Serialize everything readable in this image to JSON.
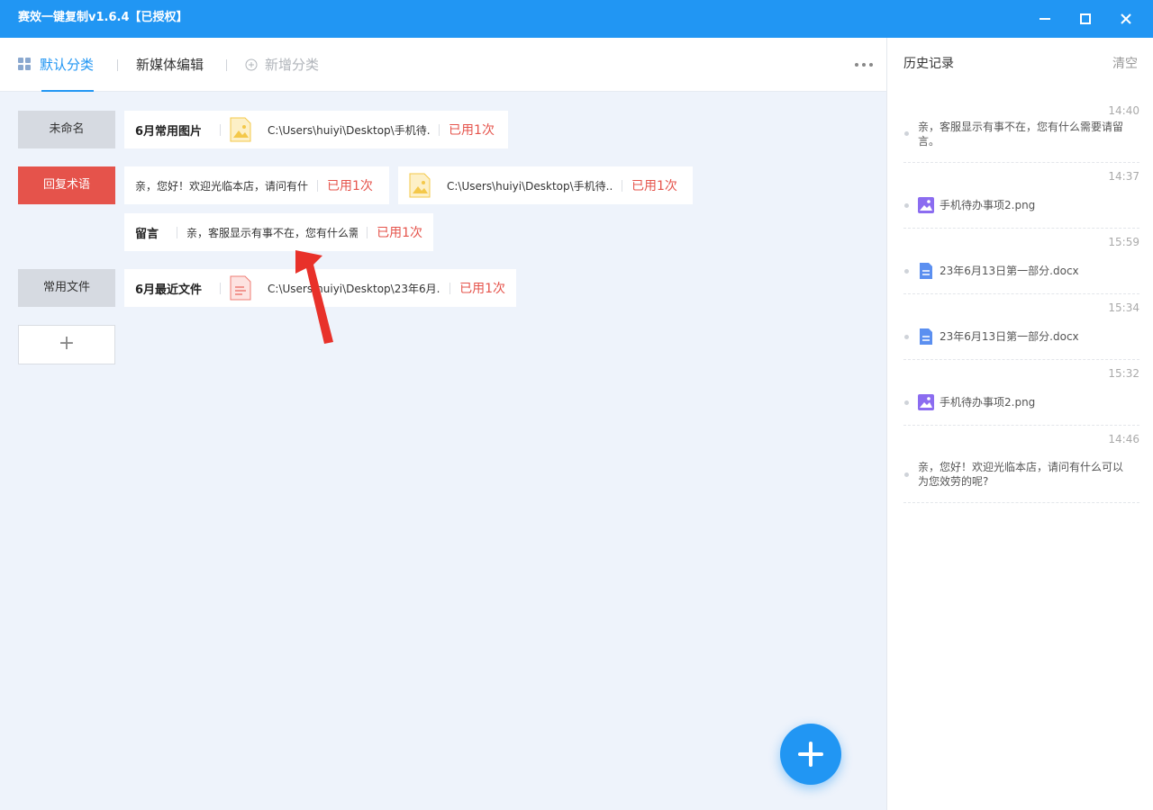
{
  "window": {
    "title": "赛效一键复制v1.6.4【已授权】"
  },
  "tabs": [
    {
      "label": "默认分类"
    },
    {
      "label": "新媒体编辑"
    },
    {
      "label": "新增分类"
    }
  ],
  "categories": [
    {
      "label": "未命名"
    },
    {
      "label": "回复术语"
    },
    {
      "label": "常用文件"
    },
    {
      "label": "+"
    }
  ],
  "cards": [
    {
      "name": "6月常用图片",
      "text": "C:\\Users\\huiyi\\Desktop\\手机待...",
      "used": "已用1次"
    },
    {
      "name": "",
      "text": "亲，您好！欢迎光临本店，请问有什",
      "used": "已用1次"
    },
    {
      "name": "",
      "text": "C:\\Users\\huiyi\\Desktop\\手机待...",
      "used": "已用1次"
    },
    {
      "name": "留言",
      "text": "亲，客服显示有事不在，您有什么需",
      "used": "已用1次"
    },
    {
      "name": "6月最近文件",
      "text": "C:\\Users\\huiyi\\Desktop\\23年6月...",
      "used": "已用1次"
    }
  ],
  "history": {
    "title": "历史记录",
    "clear_label": "清空",
    "items": [
      {
        "time": "14:40",
        "text": "亲，客服显示有事不在，您有什么需要请留言。",
        "icon": "text"
      },
      {
        "time": "14:37",
        "text": "手机待办事项2.png",
        "icon": "image-icon"
      },
      {
        "time": "15:59",
        "text": "23年6月13日第一部分.docx",
        "icon": "doc-icon"
      },
      {
        "time": "15:34",
        "text": "23年6月13日第一部分.docx",
        "icon": "doc-icon"
      },
      {
        "time": "15:32",
        "text": "手机待办事项2.png",
        "icon": "image-icon"
      },
      {
        "time": "14:46",
        "text": "亲，您好！欢迎光临本店，请问有什么可以为您效劳的呢?",
        "icon": "text"
      }
    ]
  },
  "colors": {
    "accent": "#2196f3",
    "danger": "#e5534b",
    "image_icon": "#f4c84a",
    "doc_icon": "#5b8ff0"
  }
}
